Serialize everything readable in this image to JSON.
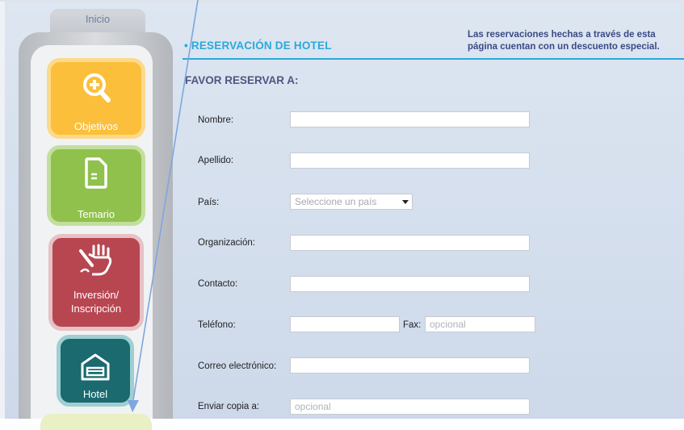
{
  "nav": {
    "home_tab": "Inicio",
    "items": [
      {
        "label": "Objetivos",
        "icon": "zoom-in-icon"
      },
      {
        "label": "Temario",
        "icon": "document-icon"
      },
      {
        "label_line1": "Inversión/",
        "label_line2": "Inscripción",
        "icon": "signing-hand-icon"
      },
      {
        "label": "Hotel",
        "icon": "hotel-icon"
      }
    ]
  },
  "main": {
    "section_title": "• RESERVACIÓN DE HOTEL",
    "section_note": "Las reservaciones hechas a través de esta página cuentan con un descuento especial.",
    "form_heading": "FAVOR RESERVAR A:",
    "fields": {
      "nombre": {
        "label": "Nombre:",
        "value": ""
      },
      "apellido": {
        "label": "Apellido:",
        "value": ""
      },
      "pais": {
        "label": "País:",
        "selected": "Seleccione un país"
      },
      "organizacion": {
        "label": "Organización:",
        "value": ""
      },
      "contacto": {
        "label": "Contacto:",
        "value": ""
      },
      "telefono": {
        "label": "Teléfono:",
        "value": ""
      },
      "fax": {
        "label": "Fax:",
        "placeholder": "opcional"
      },
      "correo": {
        "label": "Correo electrónico:",
        "value": ""
      },
      "copia": {
        "label": "Enviar copia a:",
        "placeholder": "opcional"
      }
    }
  },
  "colors": {
    "accent_blue": "#2aa9d8",
    "heading_navy": "#3a4a86",
    "objetivos": "#fbbf3b",
    "temario": "#8fc14c",
    "inversion": "#b74650",
    "hotel": "#1a6a6f",
    "arrow": "#7ea6e0"
  }
}
